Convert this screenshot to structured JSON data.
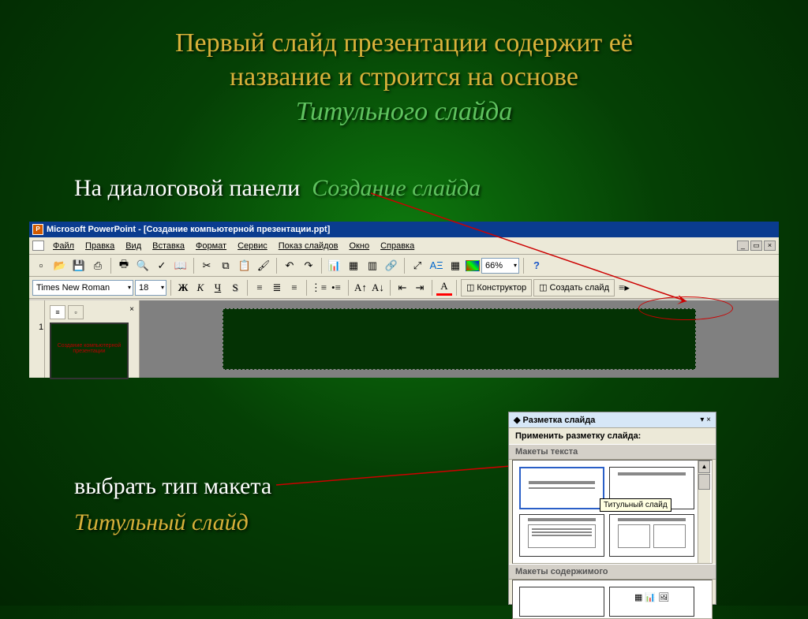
{
  "title": {
    "line1": "Первый слайд презентации содержит её",
    "line2": "название и строится на основе",
    "sub": "Титульного слайда"
  },
  "annot": {
    "prefix": "На диалоговой панели",
    "panel": "Создание слайда",
    "choose": "выбрать тип макета",
    "layout": "Титульный слайд"
  },
  "app": {
    "title": "Microsoft PowerPoint - [Создание компьютерной презентации.ppt]",
    "menus": [
      "Файл",
      "Правка",
      "Вид",
      "Вставка",
      "Формат",
      "Сервис",
      "Показ слайдов",
      "Окно",
      "Справка"
    ],
    "font": "Times New Roman",
    "fontsize": "18",
    "zoom": "66%",
    "designer": "Конструктор",
    "newslide": "Создать слайд",
    "slidenum": "1",
    "thumbtext": "Создание компьютерной презентации"
  },
  "taskpane": {
    "title": "Разметка слайда",
    "apply": "Применить разметку слайда:",
    "section1": "Макеты текста",
    "tooltip": "Титульный слайд",
    "section2": "Макеты содержимого"
  }
}
